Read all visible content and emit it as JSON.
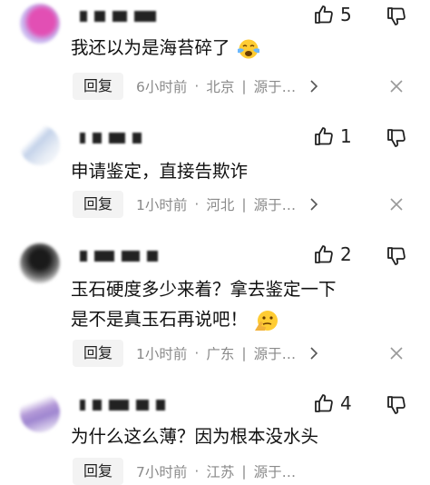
{
  "comments": [
    {
      "text": "我还以为是海苔碎了",
      "emoji": "crying-face",
      "likes": "5",
      "reply_label": "回复",
      "time": "6小时前",
      "location": "北京",
      "source": "源于…"
    },
    {
      "text": "申请鉴定，直接告欺诈",
      "likes": "1",
      "reply_label": "回复",
      "time": "1小时前",
      "location": "河北",
      "source": "源于…"
    },
    {
      "text_line1": "玉石硬度多少来着？拿去鉴定一下",
      "text_line2": "是不是真玉石再说吧！",
      "emoji": "thinking-face",
      "likes": "2",
      "reply_label": "回复",
      "time": "1小时前",
      "location": "广东",
      "source": "源于…"
    },
    {
      "text": "为什么这么薄？因为根本没水头",
      "likes": "4",
      "reply_label": "回复",
      "time": "7小时前",
      "location": "江苏",
      "source": "源于…"
    }
  ],
  "colors": {
    "meta_gray": "#8a8a8a",
    "reply_bg": "#f3f3f3"
  }
}
